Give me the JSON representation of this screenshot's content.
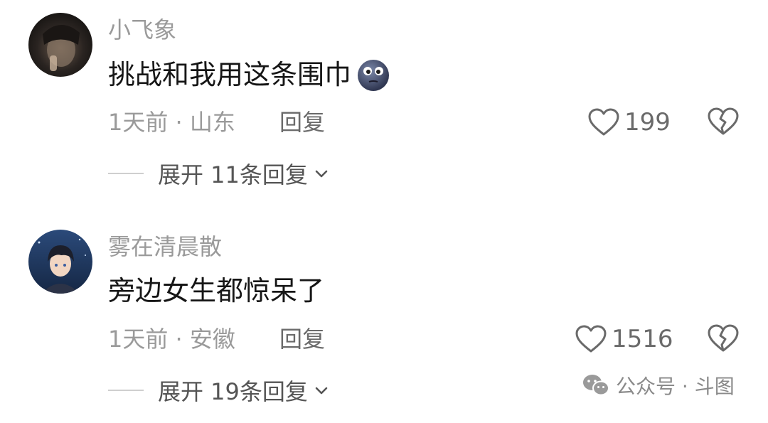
{
  "comments": [
    {
      "username": "小飞象",
      "text": "挑战和我用这条围巾",
      "emoji": "emoji-face-icon",
      "meta": "1天前 · 山东",
      "reply_label": "回复",
      "likes": "199",
      "expand_label": "展开 11条回复"
    },
    {
      "username": "雾在清晨散",
      "text": "旁边女生都惊呆了",
      "meta": "1天前 · 安徽",
      "reply_label": "回复",
      "likes": "1516",
      "expand_label": "展开 19条回复"
    }
  ],
  "watermark": {
    "text": "公众号 · 斗图"
  }
}
